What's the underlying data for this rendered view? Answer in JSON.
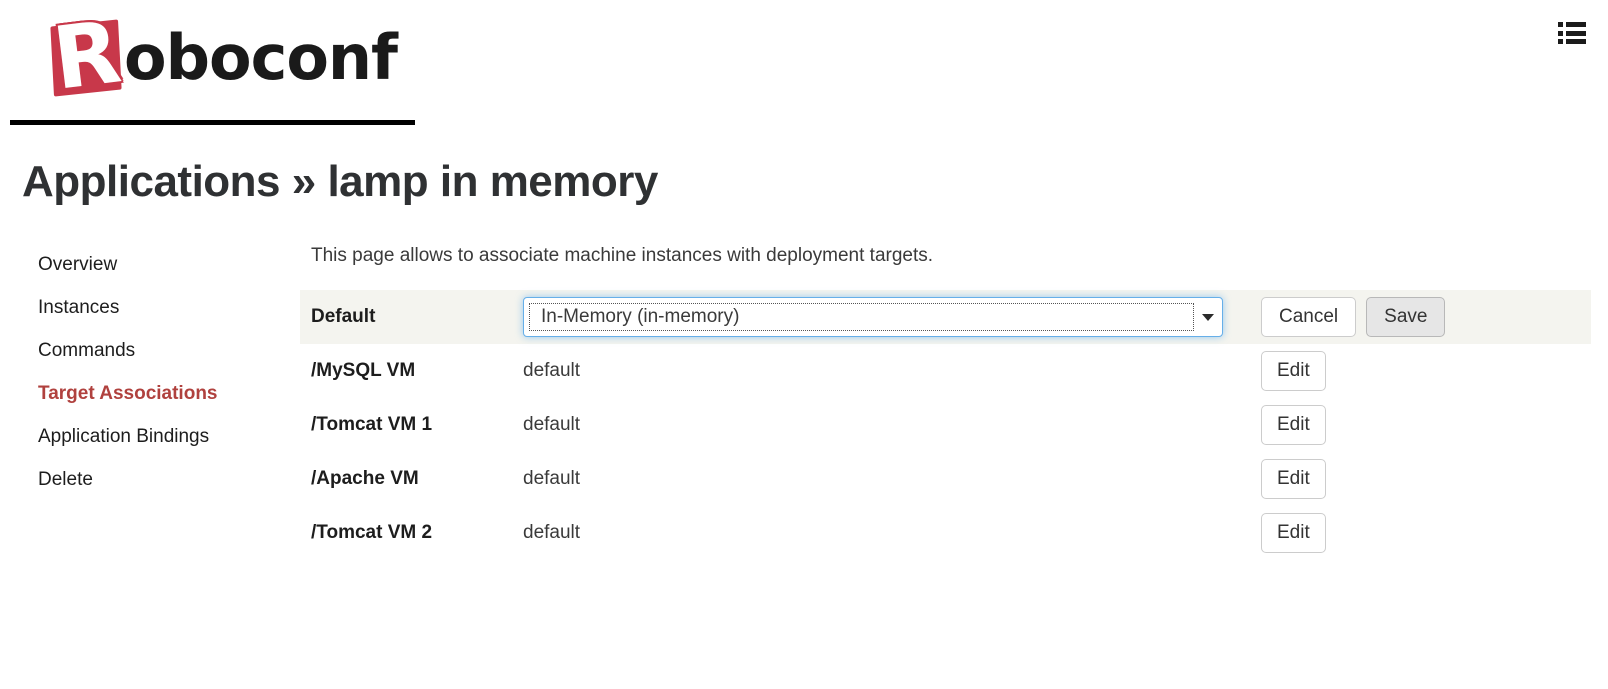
{
  "header": {
    "logo_letter": "R",
    "logo_text": "oboconf",
    "menu_icon": "list-icon"
  },
  "page_title": "Applications » lamp in memory",
  "sidebar": {
    "items": [
      {
        "label": "Overview",
        "active": false
      },
      {
        "label": "Instances",
        "active": false
      },
      {
        "label": "Commands",
        "active": false
      },
      {
        "label": "Target Associations",
        "active": true
      },
      {
        "label": "Application Bindings",
        "active": false
      },
      {
        "label": "Delete",
        "active": false
      }
    ],
    "active_color": "#b0413e"
  },
  "main": {
    "intro": "This page allows to associate machine instances with deployment targets.",
    "default_row": {
      "name": "Default",
      "select_value": "In-Memory (in-memory)",
      "cancel_label": "Cancel",
      "save_label": "Save",
      "highlight_color": "#f4f4ef",
      "focus_color": "#66afe9"
    },
    "edit_label": "Edit",
    "rows": [
      {
        "name": "/MySQL VM",
        "value": "default"
      },
      {
        "name": "/Tomcat VM 1",
        "value": "default"
      },
      {
        "name": "/Apache VM",
        "value": "default"
      },
      {
        "name": "/Tomcat VM 2",
        "value": "default"
      }
    ]
  }
}
